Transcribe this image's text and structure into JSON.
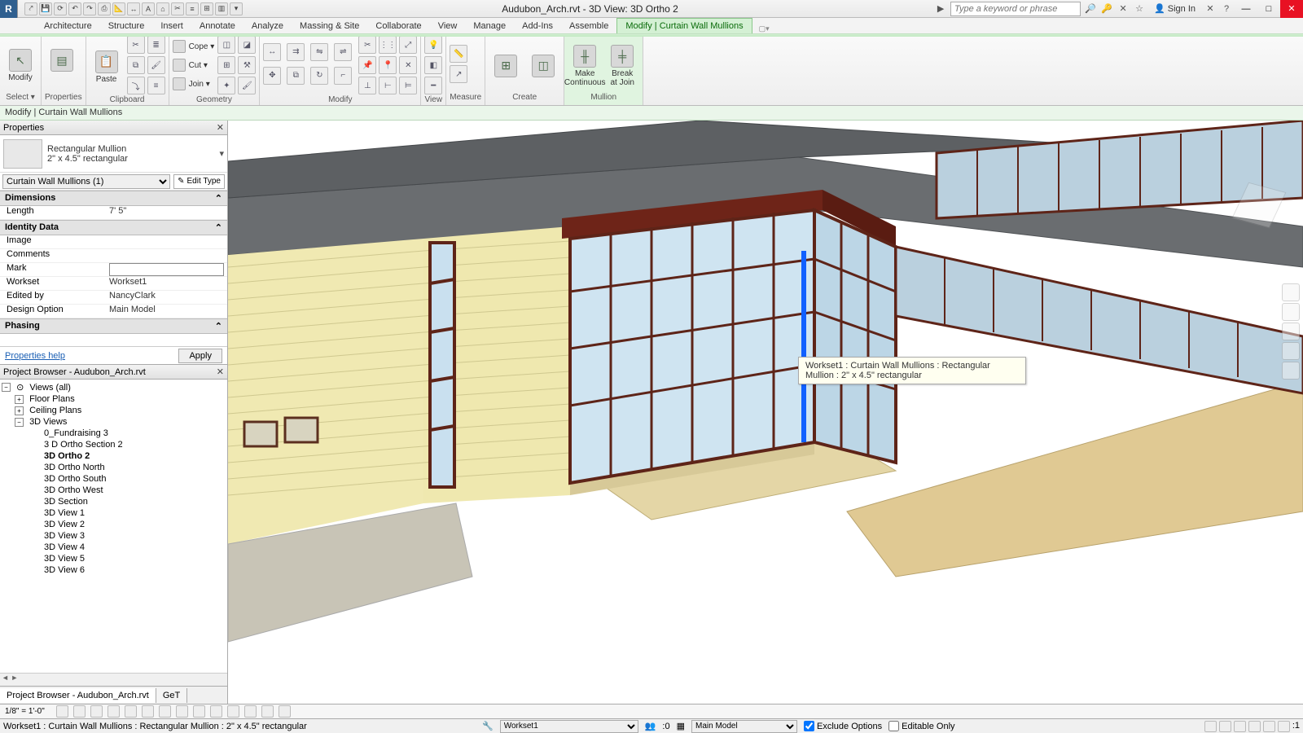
{
  "titlebar": {
    "title": "Audubon_Arch.rvt - 3D View: 3D Ortho 2",
    "search_placeholder": "Type a keyword or phrase",
    "signin": "Sign In"
  },
  "ribbon_tabs": [
    "Architecture",
    "Structure",
    "Insert",
    "Annotate",
    "Analyze",
    "Massing & Site",
    "Collaborate",
    "View",
    "Manage",
    "Add-Ins",
    "Assemble",
    "Modify | Curtain Wall Mullions"
  ],
  "ribbon_tabs_active": 11,
  "context_bar": "Modify | Curtain Wall Mullions",
  "ribbon_panels": {
    "modify_btn": "Modify",
    "select": "Select ▾",
    "properties_btn": "Properties",
    "properties": "Properties",
    "paste_btn": "Paste",
    "clipboard": "Clipboard",
    "cope": "Cope ▾",
    "cut": "Cut ▾",
    "join": "Join ▾",
    "geometry": "Geometry",
    "modify": "Modify",
    "view": "View",
    "measure": "Measure",
    "create": "Create",
    "make_cont": "Make\nContinuous",
    "break_join": "Break\nat Join",
    "mullion": "Mullion"
  },
  "properties": {
    "header": "Properties",
    "type_name": "Rectangular Mullion",
    "type_size": "2\" x 4.5\" rectangular",
    "filter": "Curtain Wall Mullions (1)",
    "edit_type": "Edit Type",
    "groups": {
      "dimensions": "Dimensions",
      "identity": "Identity Data",
      "phasing": "Phasing"
    },
    "rows": {
      "length_k": "Length",
      "length_v": "7'   5\"",
      "image_k": "Image",
      "image_v": "",
      "comments_k": "Comments",
      "comments_v": "",
      "mark_k": "Mark",
      "mark_v": "",
      "workset_k": "Workset",
      "workset_v": "Workset1",
      "editedby_k": "Edited by",
      "editedby_v": "NancyClark",
      "design_k": "Design Option",
      "design_v": "Main Model"
    },
    "help": "Properties help",
    "apply": "Apply"
  },
  "browser": {
    "header": "Project Browser - Audubon_Arch.rvt",
    "root": "Views (all)",
    "floor_plans": "Floor Plans",
    "ceiling_plans": "Ceiling Plans",
    "three_d": "3D Views",
    "views3d": [
      "0_Fundraising 3",
      "3 D Ortho Section 2",
      "3D Ortho 2",
      "3D Ortho North",
      "3D Ortho South",
      "3D Ortho West",
      "3D Section",
      "3D View 1",
      "3D View 2",
      "3D View 3",
      "3D View 4",
      "3D View 5",
      "3D View 6"
    ],
    "selected_index": 2,
    "footer_tab1": "Project Browser - Audubon_Arch.rvt",
    "footer_tab2": "GeT"
  },
  "tooltip": "Workset1 : Curtain Wall Mullions : Rectangular Mullion : 2\" x 4.5\" rectangular",
  "viewbar": {
    "scale": "1/8\" = 1'-0\""
  },
  "statusbar": {
    "left": "Workset1 : Curtain Wall Mullions : Rectangular Mullion : 2\" x 4.5\" rectangular",
    "workset": "Workset1",
    "npeople": ":0",
    "model": "Main Model",
    "exclude": "Exclude Options",
    "editable": "Editable Only",
    "filter_count": ":1"
  }
}
